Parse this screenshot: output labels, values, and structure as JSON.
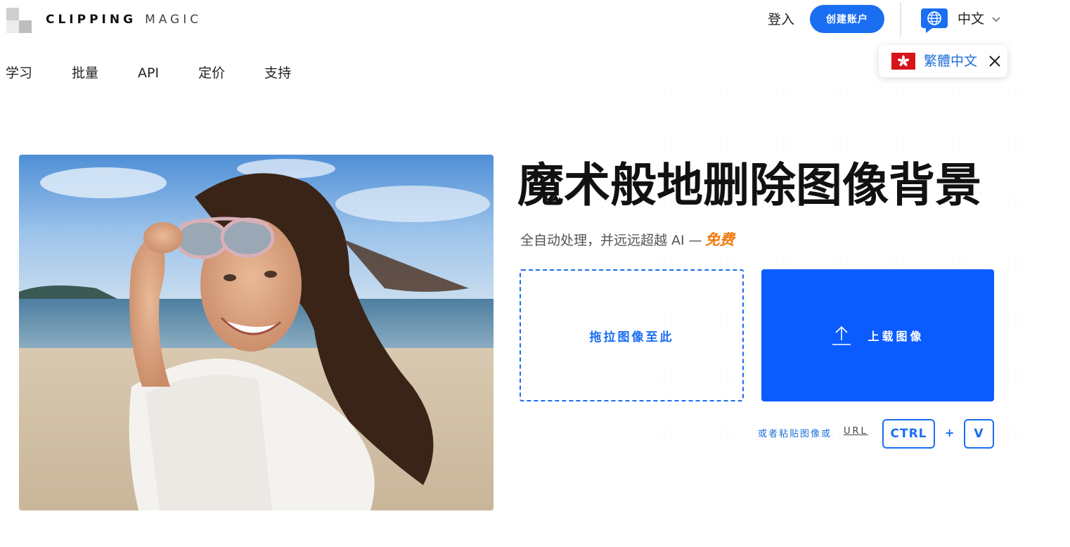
{
  "header": {
    "logo_bold": "CLIPPING",
    "logo_light": "MAGIC",
    "login_label": "登入",
    "signup_label": "创建账户",
    "language_current": "中文",
    "language_popup_option": "繁體中文",
    "language_popup_flag": "hong-kong-flag"
  },
  "nav": {
    "items": [
      "学习",
      "批量",
      "API",
      "定价",
      "支持"
    ]
  },
  "hero": {
    "title": "魔术般地删除图像背景",
    "subtitle_prefix": "全自动处理，并远远超越 AI —",
    "subtitle_free": "免费",
    "drop_label": "拖拉图像至此",
    "upload_label": "上载图像",
    "upload_icon": "upload-arrow-icon",
    "paste_text": "或者粘贴图像或",
    "paste_url": "URL",
    "key_ctrl": "CTRL",
    "key_plus": "+",
    "key_v": "V"
  },
  "colors": {
    "accent_blue": "#1a6ef2",
    "upload_blue": "#0a5cff",
    "free_orange": "#f07a0f"
  }
}
